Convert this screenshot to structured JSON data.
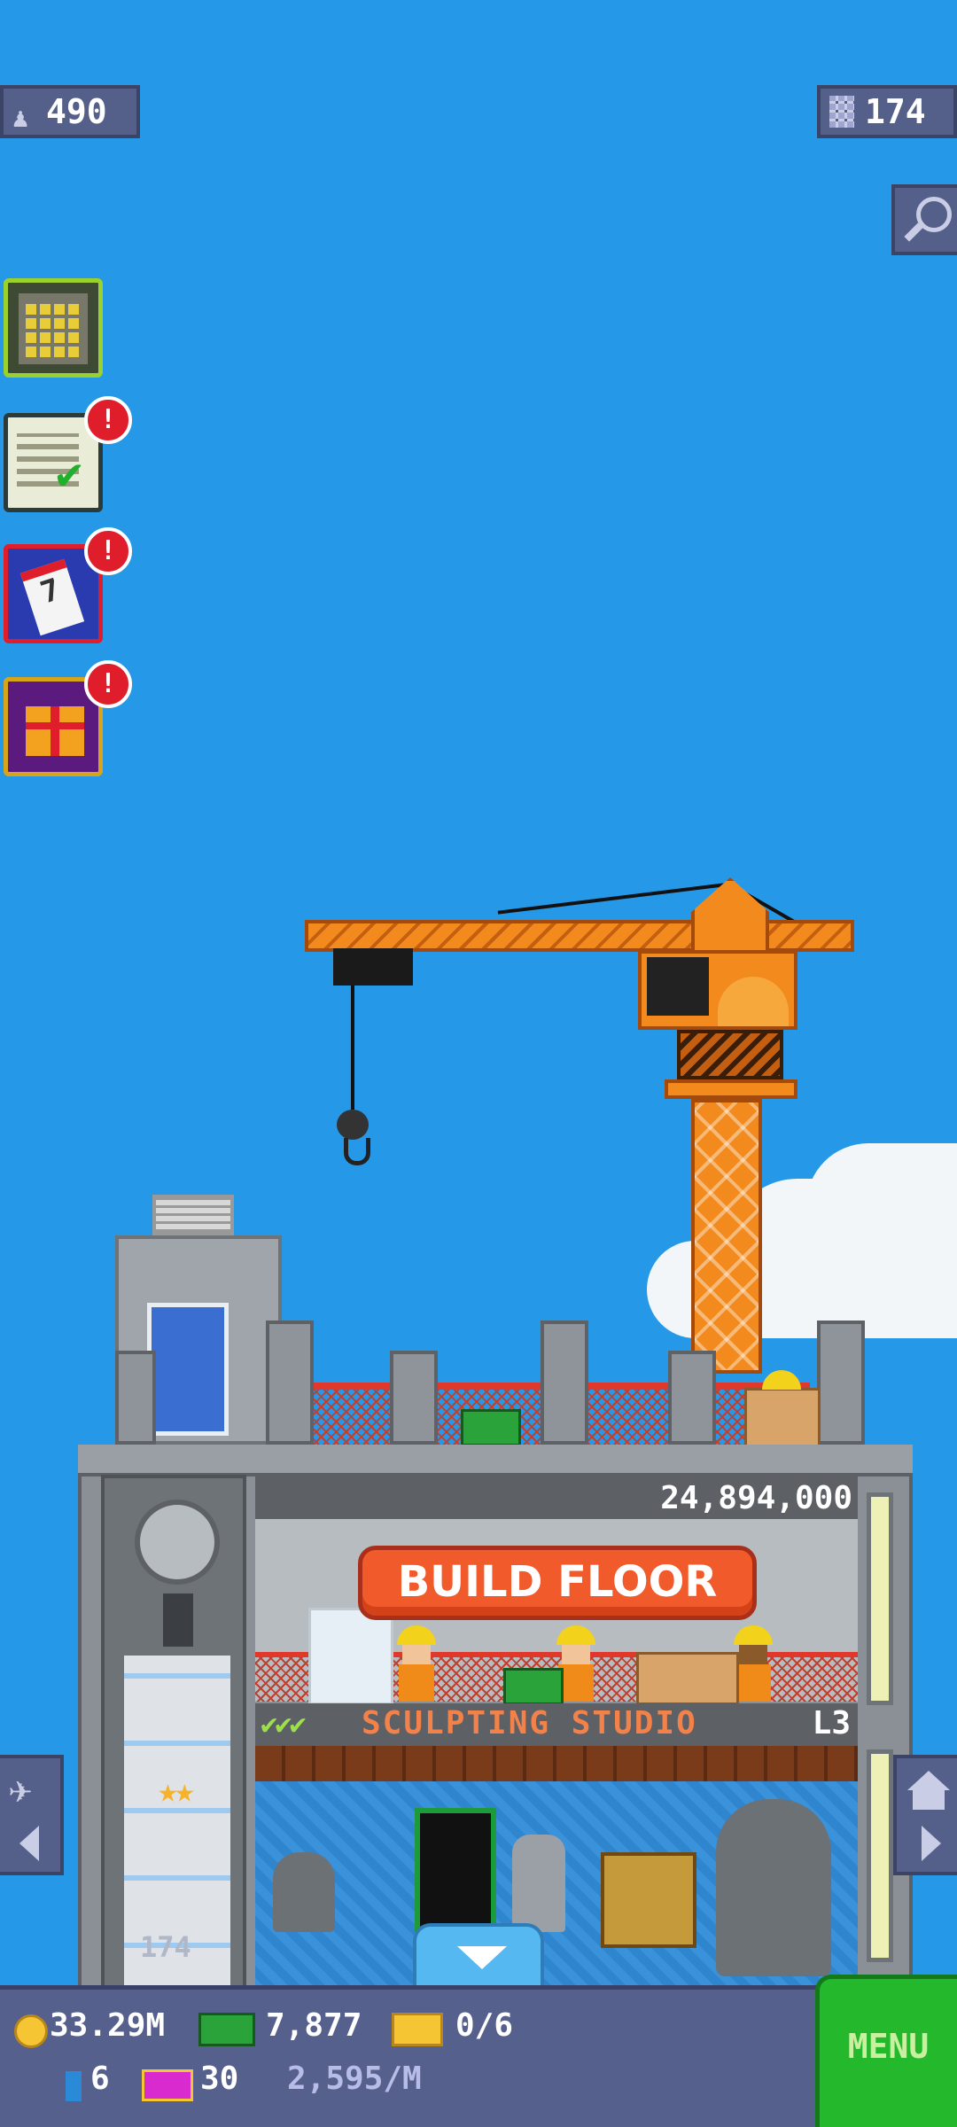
{
  "hud": {
    "population": "490",
    "floors": "174"
  },
  "side_menu": {
    "items": [
      {
        "name": "tower-building",
        "badge": ""
      },
      {
        "name": "missions",
        "badge": "!"
      },
      {
        "name": "calendar",
        "badge": "!"
      },
      {
        "name": "gift",
        "badge": "!"
      }
    ]
  },
  "construction": {
    "cost": "24,894,000",
    "build_label": "BUILD FLOOR"
  },
  "floor": {
    "name": "SCULPTING STUDIO",
    "level": "L3"
  },
  "elevator": {
    "floor_number": "174"
  },
  "bottom_bar": {
    "coins": "33.29M",
    "bux": "7,877",
    "vip_tickets": "0/6",
    "ticket_count": "6",
    "medals": "30",
    "rate": "2,595/M",
    "menu_label": "MENU"
  },
  "colors": {
    "sky": "#2599e8",
    "crane": "#f28a1e",
    "build_button": "#f15a2a",
    "menu": "#24b82c",
    "bottom_bar": "#56608c"
  }
}
